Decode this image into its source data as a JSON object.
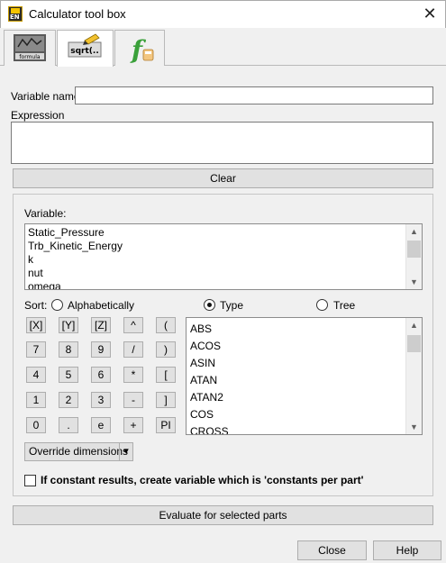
{
  "window": {
    "title": "Calculator tool box",
    "close_glyph": "✕"
  },
  "app_icon": {
    "text": "EN",
    "icon": "ensight-app-icon"
  },
  "tabs": [
    {
      "name": "formula-tab",
      "icon": "formula-image-icon",
      "selected": false,
      "lines": [
        "",
        "",
        "formula"
      ]
    },
    {
      "name": "sqrt-tab",
      "icon": "sqrt-pencil-icon",
      "selected": true,
      "text": "sqrt(.."
    },
    {
      "name": "function-tab",
      "icon": "function-fx-icon",
      "selected": false,
      "text": "f"
    }
  ],
  "variable_name": {
    "label": "Variable name",
    "value": ""
  },
  "expression": {
    "label": "Expression",
    "value": ""
  },
  "clear_label": "Clear",
  "variable_section": {
    "label": "Variable:",
    "items": [
      "Static_Pressure",
      "Trb_Kinetic_Energy",
      "k",
      "nut",
      "omega"
    ]
  },
  "sort": {
    "label": "Sort:",
    "options": [
      {
        "label": "Alphabetically",
        "selected": false
      },
      {
        "label": "Type",
        "selected": true
      },
      {
        "label": "Tree",
        "selected": false
      }
    ]
  },
  "keypad": {
    "rows": [
      [
        "[X]",
        "[Y]",
        "[Z]",
        "^",
        "("
      ],
      [
        "7",
        "8",
        "9",
        "/",
        ")"
      ],
      [
        "4",
        "5",
        "6",
        "*",
        "["
      ],
      [
        "1",
        "2",
        "3",
        "-",
        "]"
      ],
      [
        "0",
        ".",
        "e",
        "+",
        "PI"
      ]
    ]
  },
  "functions": {
    "items": [
      "ABS",
      "ACOS",
      "ASIN",
      "ATAN",
      "ATAN2",
      "COS",
      "CROSS"
    ]
  },
  "override_dimensions": {
    "label": "Override dimensions",
    "arrow": "▾"
  },
  "constant_checkbox": {
    "checked": false,
    "label": "If constant results, create variable which is 'constants per part'"
  },
  "evaluate_label": "Evaluate for selected parts",
  "close_label": "Close",
  "help_label": "Help",
  "scroll_glyphs": {
    "up": "▲",
    "down": "▼"
  }
}
